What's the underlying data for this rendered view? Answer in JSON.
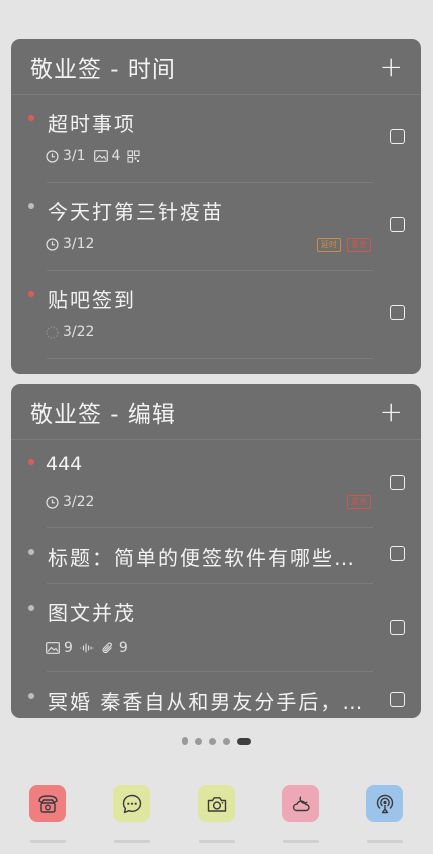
{
  "widget_time": {
    "title": "敬业签 - 时间",
    "items": [
      {
        "title": "超时事项",
        "date": "3/1",
        "image_count": "4",
        "status_color": "red"
      },
      {
        "title": "今天打第三针疫苗",
        "date": "3/12",
        "tags": [
          "延时",
          "紧急"
        ],
        "status_color": "grey"
      },
      {
        "title": "贴吧签到",
        "date": "3/22",
        "status_color": "red"
      }
    ]
  },
  "widget_edit": {
    "title": "敬业签 - 编辑",
    "items": [
      {
        "title": "444",
        "date": "3/22",
        "tags": [
          "紧急"
        ],
        "status_color": "red"
      },
      {
        "title": "标题：简单的便签软件有哪些…",
        "status_color": "grey"
      },
      {
        "title": "图文并茂",
        "image_count": "9",
        "attachment_count": "9",
        "status_color": "grey"
      },
      {
        "title": "冥婚 秦香自从和男友分手后，…",
        "status_color": "grey"
      }
    ]
  },
  "page_indicator": {
    "count": 5,
    "active": 4
  },
  "dock": [
    {
      "name": "phone-icon",
      "bg": "#ef7f7f"
    },
    {
      "name": "message-icon",
      "bg": "#dfe6a0"
    },
    {
      "name": "camera-icon",
      "bg": "#dfe6a0"
    },
    {
      "name": "weather-icon",
      "bg": "#eea8b5"
    },
    {
      "name": "podcast-icon",
      "bg": "#9cc3ea"
    }
  ]
}
